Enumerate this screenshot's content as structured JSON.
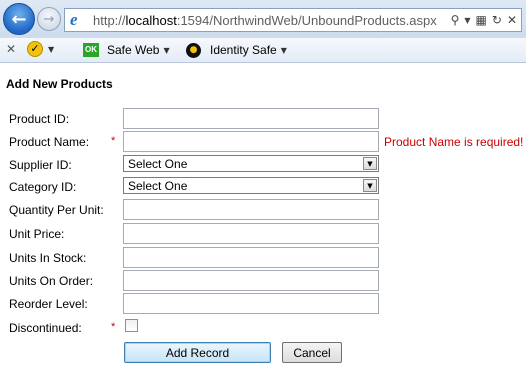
{
  "browser": {
    "url_prefix": "http://",
    "url_host": "localhost",
    "url_rest": ":1594/NorthwindWeb/UnboundProducts.aspx",
    "back_icon": "back-arrow-icon",
    "forward_icon": "forward-arrow-icon"
  },
  "toolbar": {
    "safe_web_label": "Safe Web",
    "identity_safe_label": "Identity Safe",
    "ok_badge": "OK"
  },
  "page": {
    "title": "Add New Products"
  },
  "form": {
    "product_id": {
      "label": "Product ID:",
      "value": ""
    },
    "product_name": {
      "label": "Product Name:",
      "value": "",
      "required_mark": "*",
      "error": "Product Name is required!"
    },
    "supplier_id": {
      "label": "Supplier ID:",
      "selected": "Select One"
    },
    "category_id": {
      "label": "Category ID:",
      "selected": "Select One"
    },
    "quantity_per_unit": {
      "label": "Quantity Per Unit:",
      "value": ""
    },
    "unit_price": {
      "label": "Unit Price:",
      "value": ""
    },
    "units_in_stock": {
      "label": "Units In Stock:",
      "value": ""
    },
    "units_on_order": {
      "label": "Units On Order:",
      "value": ""
    },
    "reorder_level": {
      "label": "Reorder Level:",
      "value": ""
    },
    "discontinued": {
      "label": "Discontinued:",
      "required_mark": "*",
      "checked": false
    }
  },
  "buttons": {
    "add_record": "Add Record",
    "cancel": "Cancel"
  },
  "colors": {
    "error": "#cc0000",
    "accent": "#1f66c4"
  }
}
